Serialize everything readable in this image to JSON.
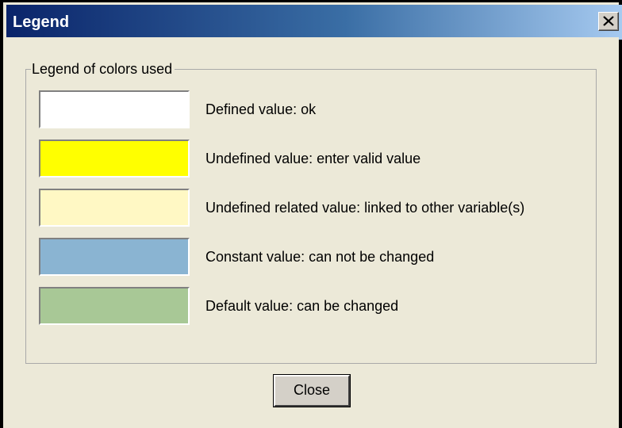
{
  "window": {
    "title": "Legend"
  },
  "legend_group": {
    "label": "Legend of colors used",
    "items": [
      {
        "color": "#ffffff",
        "label": "Defined value: ok"
      },
      {
        "color": "#ffff00",
        "label": "Undefined value: enter valid value"
      },
      {
        "color": "#fff8c4",
        "label": "Undefined related value: linked to other variable(s)"
      },
      {
        "color": "#8ab4d2",
        "label": "Constant value: can not be changed"
      },
      {
        "color": "#a8c896",
        "label": "Default value: can be changed"
      }
    ]
  },
  "buttons": {
    "close_label": "Close"
  },
  "icons": {
    "title_close": "close-icon"
  }
}
